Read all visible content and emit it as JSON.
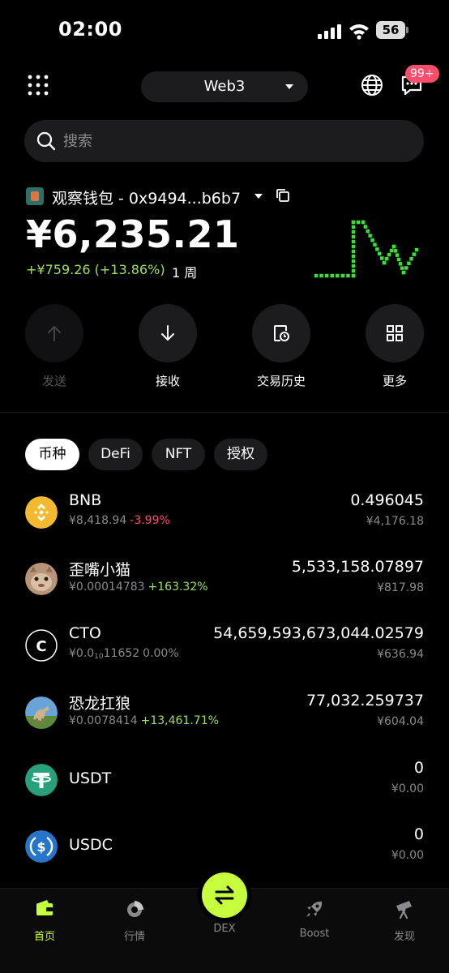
{
  "status_bar": {
    "time": "02:00",
    "battery": "56"
  },
  "header": {
    "network": "Web3",
    "badge": "99+"
  },
  "search": {
    "placeholder": "搜索"
  },
  "wallet": {
    "name": "观察钱包 - 0x9494...b6b7",
    "balance": "¥6,235.21",
    "change": "+¥759.26 (+13.86%)",
    "period": "1 周"
  },
  "actions": [
    "发送",
    "接收",
    "交易历史",
    "更多"
  ],
  "tabs": [
    "币种",
    "DeFi",
    "NFT",
    "授权"
  ],
  "tokens": [
    {
      "name": "BNB",
      "price": "¥8,418.94",
      "change": "-3.99%",
      "amount": "0.496045",
      "value": "¥4,176.18"
    },
    {
      "name": "歪嘴小猫",
      "price": "¥0.00014783",
      "change": "+163.32%",
      "amount": "5,533,158.07897",
      "value": "¥817.98"
    },
    {
      "name": "CTO",
      "price_prefix": "¥0.0",
      "price_sub": "10",
      "price_rest": "11652",
      "change": "0.00%",
      "amount": "54,659,593,673,044.02579",
      "value": "¥636.94"
    },
    {
      "name": "恐龙扛狼",
      "price": "¥0.0078414",
      "change": "+13,461.71%",
      "amount": "77,032.259737",
      "value": "¥604.04"
    },
    {
      "name": "USDT",
      "amount": "0",
      "value": "¥0.00"
    },
    {
      "name": "USDC",
      "amount": "0",
      "value": "¥0.00"
    }
  ],
  "nav": [
    "首页",
    "行情",
    "DEX",
    "Boost",
    "发现"
  ],
  "colors": {
    "accent": "#c6ff3d",
    "positive": "#9be35a",
    "negative": "#ff4d6d",
    "background": "#000000"
  },
  "icons": [
    "signal-icon",
    "wifi-icon",
    "battery-icon",
    "apps-grid-icon",
    "globe-icon",
    "message-icon",
    "search-icon",
    "copy-icon",
    "arrow-up-icon",
    "arrow-down-icon",
    "history-icon",
    "grid-icon",
    "swap-icon",
    "wallet-icon",
    "market-icon",
    "rocket-icon",
    "telescope-icon"
  ]
}
